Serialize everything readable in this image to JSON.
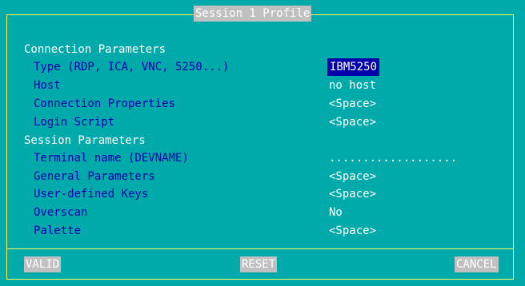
{
  "window": {
    "title": "Session 1 Profile"
  },
  "sections": [
    {
      "title": "Connection Parameters"
    },
    {
      "title": "Session Parameters"
    }
  ],
  "fields": [
    {
      "label": "Type (RDP, ICA, VNC, 5250...)",
      "value": "IBM5250",
      "selected": true
    },
    {
      "label": "Host",
      "value": "no host"
    },
    {
      "label": "Connection Properties",
      "value": "<Space>"
    },
    {
      "label": "Login Script",
      "value": "<Space>"
    },
    {
      "label": "Terminal name (DEVNAME)",
      "value": "..................."
    },
    {
      "label": "General Parameters",
      "value": "<Space>"
    },
    {
      "label": "User-defined Keys",
      "value": "<Space>"
    },
    {
      "label": "Overscan",
      "value": "No"
    },
    {
      "label": "Palette",
      "value": "<Space>"
    }
  ],
  "buttons": {
    "valid": "VALID",
    "reset": "RESET",
    "cancel": "CANCEL"
  },
  "colors": {
    "background": "#00aaaa",
    "border": "#ffff55",
    "label": "#0000aa",
    "value": "#ffffff",
    "selection": "#0000aa"
  }
}
